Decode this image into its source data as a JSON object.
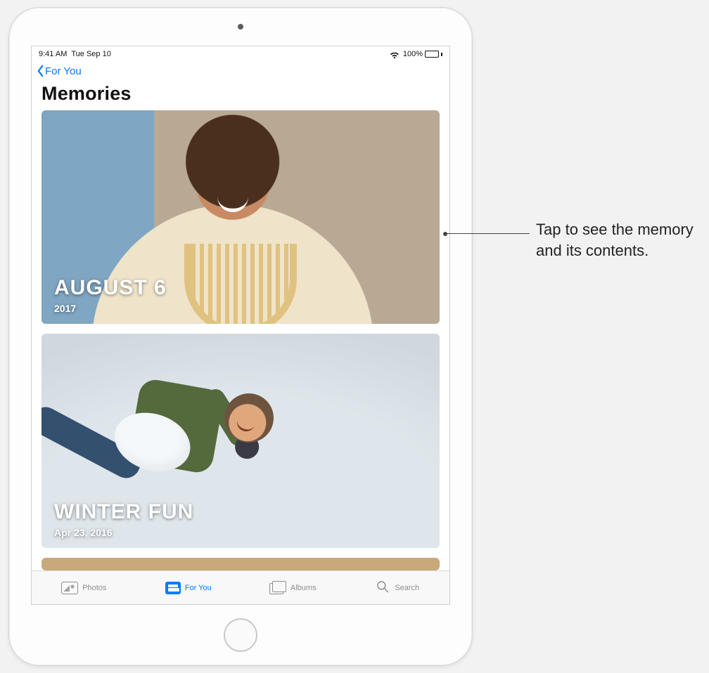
{
  "status_bar": {
    "time": "9:41 AM",
    "date": "Tue Sep 10",
    "battery_pct": "100%"
  },
  "nav": {
    "back_label": "For You"
  },
  "page": {
    "title": "Memories"
  },
  "memories": [
    {
      "title": "AUGUST 6",
      "subtitle": "2017"
    },
    {
      "title": "WINTER FUN",
      "subtitle": "Apr 23, 2016"
    }
  ],
  "tabs": {
    "photos": "Photos",
    "for_you": "For You",
    "albums": "Albums",
    "search": "Search",
    "active": "for_you"
  },
  "callout": {
    "text": "Tap to see the memory and its contents."
  }
}
